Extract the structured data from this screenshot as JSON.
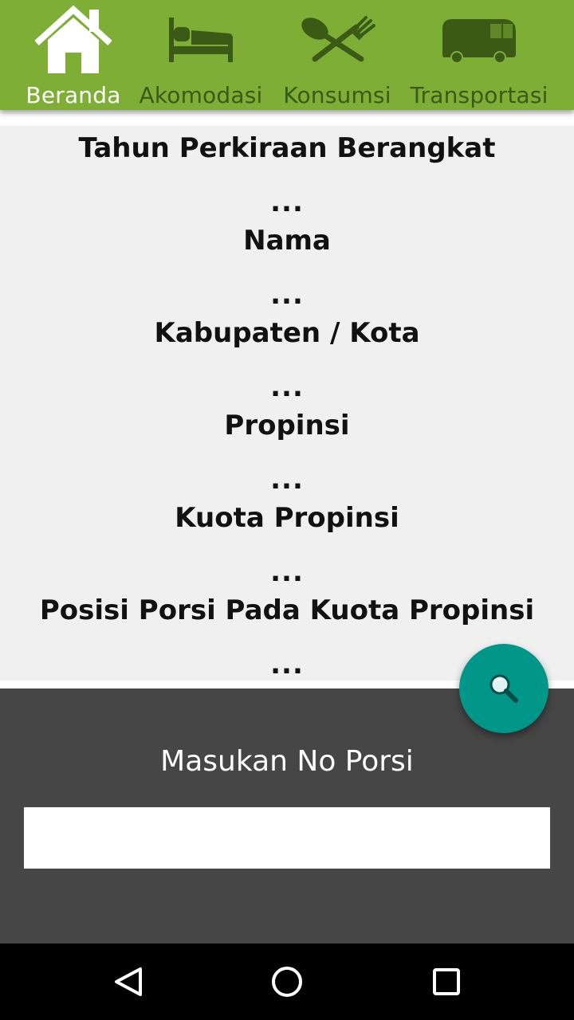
{
  "nav": {
    "items": [
      {
        "label": "Beranda",
        "icon": "home-icon",
        "active": true
      },
      {
        "label": "Akomodasi",
        "icon": "bed-icon",
        "active": false
      },
      {
        "label": "Konsumsi",
        "icon": "spoon-fork-icon",
        "active": false
      },
      {
        "label": "Transportasi",
        "icon": "bus-icon",
        "active": false
      }
    ],
    "colors": {
      "bar": "#7fae37",
      "active_text": "#ffffff",
      "inactive": "#3b5a16"
    }
  },
  "info": {
    "fields": [
      {
        "label": "Tahun Perkiraan Berangkat",
        "value": "..."
      },
      {
        "label": "Nama",
        "value": "..."
      },
      {
        "label": "Kabupaten / Kota",
        "value": "..."
      },
      {
        "label": "Propinsi",
        "value": "..."
      },
      {
        "label": "Kuota Propinsi",
        "value": "..."
      },
      {
        "label": "Posisi Porsi Pada Kuota Propinsi",
        "value": "..."
      }
    ]
  },
  "input_panel": {
    "title": "Masukan No Porsi",
    "value": "",
    "placeholder": ""
  },
  "fab": {
    "icon": "search-icon",
    "color": "#009688"
  },
  "system_nav": {
    "back_icon": "back-icon",
    "home_icon": "home-circle-icon",
    "recent_icon": "recent-apps-icon"
  }
}
